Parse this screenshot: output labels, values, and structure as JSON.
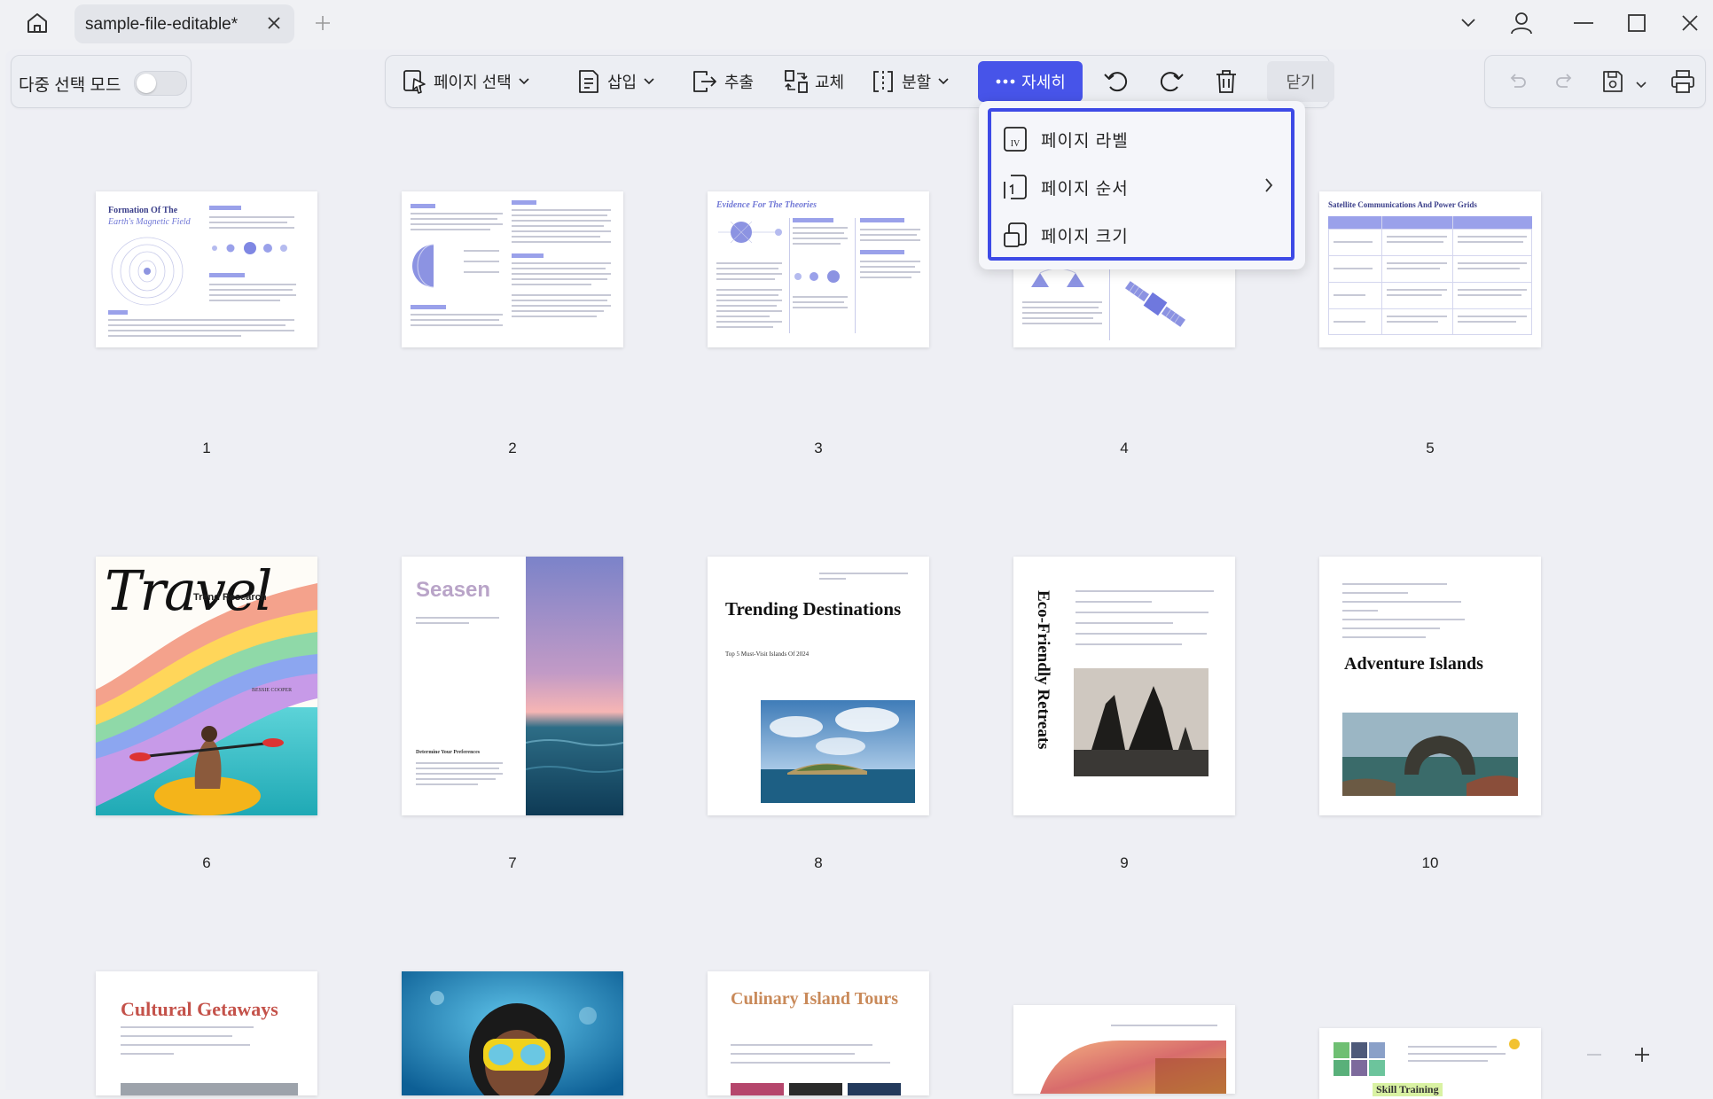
{
  "titlebar": {
    "tab_title": "sample-file-editable*"
  },
  "multi_select": {
    "label": "다중 선택 모드",
    "enabled": false
  },
  "toolbar": {
    "page_select": "페이지 선택",
    "insert": "삽입",
    "extract": "추출",
    "replace": "교체",
    "split": "분할",
    "more": "자세히",
    "close": "닫기",
    "accent_color": "#4754e9"
  },
  "more_menu": {
    "items": [
      {
        "label": "페이지 라벨",
        "icon": "page-label-icon"
      },
      {
        "label": "페이지 순서",
        "icon": "page-order-icon",
        "has_submenu": true
      },
      {
        "label": "페이지 크기",
        "icon": "page-size-icon"
      }
    ]
  },
  "pages": [
    {
      "number": "1",
      "title": "Formation Of The",
      "subtitle": "Earth's Magnetic Field"
    },
    {
      "number": "2"
    },
    {
      "number": "3",
      "title": "Evidence For The Theories"
    },
    {
      "number": "4"
    },
    {
      "number": "5",
      "title": "Satellite Communications And Power Grids"
    },
    {
      "number": "6",
      "title": "Travel",
      "subtitle": "Trend Research",
      "author": "BESSIE COOPER"
    },
    {
      "number": "7",
      "title": "Seasen",
      "subtitle": "Determine Your Preferences"
    },
    {
      "number": "8",
      "title": "Trending Destinations",
      "subtitle": "Top 5 Must-Visit Islands Of 2024"
    },
    {
      "number": "9",
      "title": "Eco-Friendly Retreats"
    },
    {
      "number": "10",
      "title": "Adventure Islands"
    },
    {
      "title": "Cultural Getaways"
    },
    {},
    {
      "title": "Culinary Island Tours"
    },
    {},
    {
      "title": "Skill Training"
    }
  ]
}
